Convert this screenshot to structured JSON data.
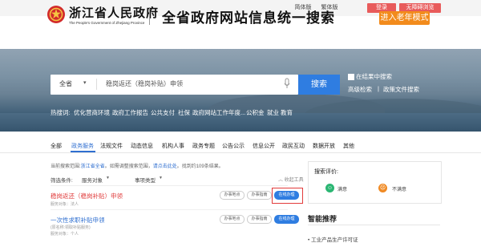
{
  "topbar": {
    "simplified": "简体版",
    "traditional": "繁体版",
    "login": "登录",
    "accessible": "无障碍浏览"
  },
  "header": {
    "logo_cn": "浙江省人民政府",
    "logo_en": "The People's Government of Zhejiang Province",
    "title": "全省政府网站信息统一搜索",
    "elder_mode": "进入老年模式"
  },
  "search": {
    "scope": "全省",
    "query": "稳岗返还（稳岗补贴）申领",
    "button": "搜索",
    "in_results": "在结果中搜索",
    "advanced": "高级检索",
    "separator": "|",
    "policy_search": "政策文件搜索"
  },
  "hot": {
    "label": "热搜词:",
    "items": [
      "优化营商环境",
      "政府工作报告",
      "公共支付",
      "社保",
      "政府网站工作年度...",
      "公积金",
      "就业",
      "教育"
    ]
  },
  "tabs": [
    "全部",
    "政务服务",
    "法规文件",
    "动态信息",
    "机构人事",
    "政务专题",
    "公告公示",
    "信息公开",
    "政民互动",
    "数据开放",
    "其他"
  ],
  "scope_info": {
    "prefix": "当前搜索范围:",
    "scope": "浙江省全省",
    "middle": "。如需调整搜索范围，",
    "link": "请点击此处",
    "suffix": "。找到约109条结果。"
  },
  "filters": {
    "label": "筛选条件:",
    "service_target": "服务对象",
    "matter_type": "事项类型",
    "collapse": "收起工具"
  },
  "results": [
    {
      "title": "稳岗返还（稳岗补贴）申领",
      "meta": "服务对象：法人",
      "buttons": [
        "办事地点",
        "办事指南",
        "在线办理"
      ],
      "color": "#e03c3c"
    },
    {
      "title": "一次性求职补贴申领",
      "meta_line1": "(原名称:领取补贴服务)",
      "meta_line2": "服务对象：个人",
      "buttons": [
        "办事地点",
        "办事指南",
        "在线办理"
      ],
      "color": "#2f6fd0"
    }
  ],
  "evaluation": {
    "title": "搜索评价:",
    "good": "满意",
    "bad": "不满意"
  },
  "smart": {
    "title": "智能推荐",
    "item": "• 工业产品生产许可证"
  },
  "colors": {
    "accent_blue": "#2f7de1",
    "elder_orange": "#f28b1c",
    "highlight_red": "#e23b3b"
  }
}
